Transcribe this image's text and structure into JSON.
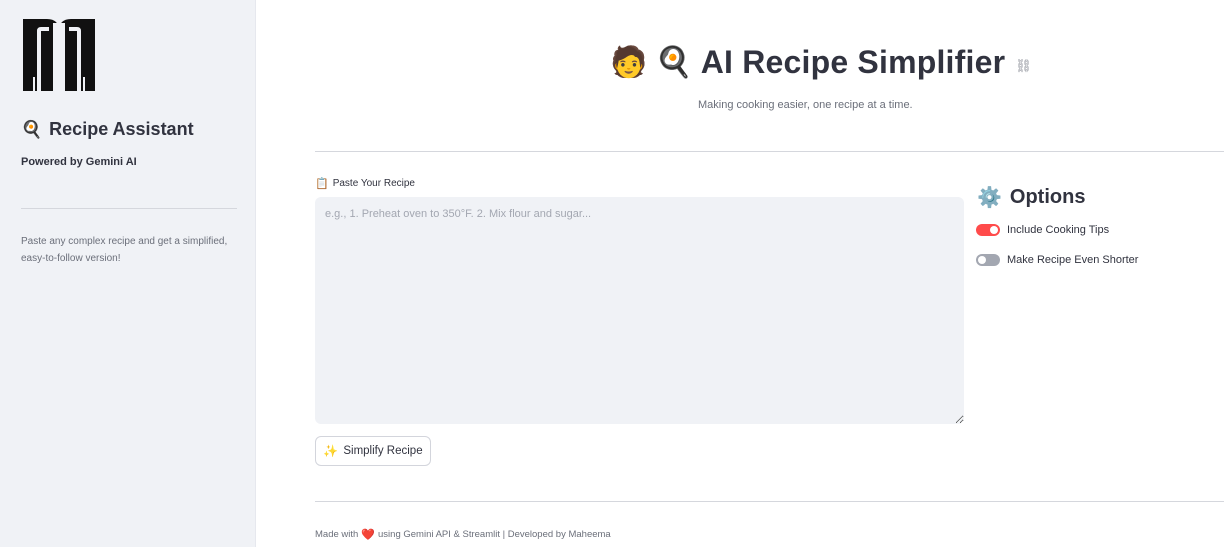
{
  "sidebar": {
    "logo_icon": "stick-figure-logo-icon",
    "title_emoji": "🍳",
    "title": "Recipe Assistant",
    "powered_by": "Powered by Gemini AI",
    "description": "Paste any complex recipe and get a simplified, easy-to-follow version!"
  },
  "header": {
    "emoji_1": "🧑",
    "emoji_2": "🍳",
    "title": "AI Recipe Simplifier",
    "link_icon": "link-icon",
    "subtitle": "Making cooking easier, one recipe at a time."
  },
  "input": {
    "label_emoji": "📋",
    "label": "Paste Your Recipe",
    "placeholder": "e.g., 1. Preheat oven to 350°F. 2. Mix flour and sugar...",
    "value": ""
  },
  "action": {
    "button_emoji": "✨",
    "button_label": "Simplify Recipe"
  },
  "options": {
    "title_emoji": "⚙️",
    "title": "Options",
    "toggles": [
      {
        "label": "Include Cooking Tips",
        "on": true
      },
      {
        "label": "Make Recipe Even Shorter",
        "on": false
      }
    ]
  },
  "footer": {
    "prefix": "Made with",
    "heart": "❤️",
    "suffix": "using Gemini API & Streamlit | Developed by Maheema"
  },
  "colors": {
    "sidebar_bg": "#f0f2f6",
    "accent": "#ff4b4b",
    "toggle_off": "#a3a7b1",
    "text": "#31333f"
  }
}
